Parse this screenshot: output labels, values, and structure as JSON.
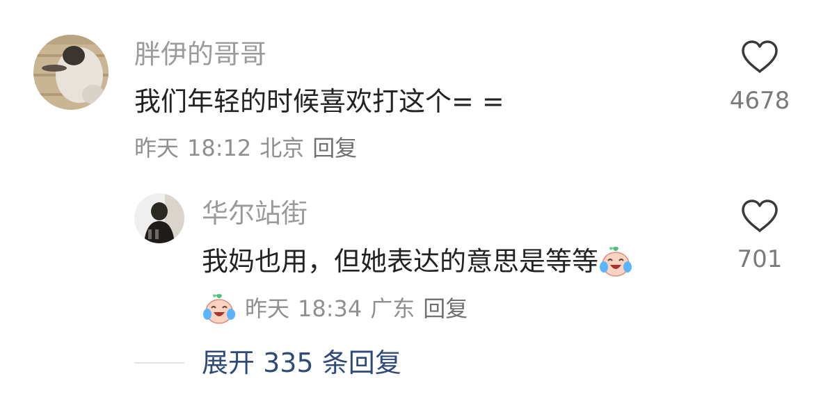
{
  "comments": [
    {
      "username": "胖伊的哥哥",
      "text": "我们年轻的时候喜欢打这个= =",
      "date": "昨天",
      "time": "18:12",
      "location": "北京",
      "reply_label": "回复",
      "likes": "4678"
    }
  ],
  "replies": [
    {
      "username": "华尔站街",
      "text": "我妈也用，但她表达的意思是等等",
      "emoji": "laughing-crying-emoji",
      "date": "昨天",
      "time": "18:34",
      "location": "广东",
      "reply_label": "回复",
      "likes": "701"
    }
  ],
  "expand": {
    "label": "展开 335 条回复"
  },
  "icons": {
    "like": "heart-outline-icon"
  },
  "colors": {
    "username": "#9a9a9a",
    "text": "#222222",
    "meta": "#8f8f8f",
    "expand_link": "#2d4a7a"
  }
}
